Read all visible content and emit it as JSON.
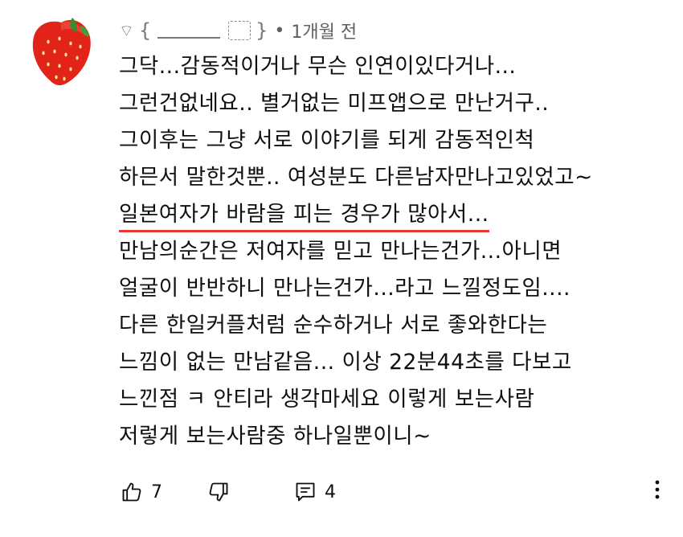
{
  "comment": {
    "author_time": "1개월 전",
    "author_prefix": "⌔",
    "separator": "•",
    "lines": [
      "그닥...감동적이거나 무슨 인연이있다거나...",
      "그런건없네요.. 별거없는 미프앱으로 만난거구..",
      "그이후는 그냥 서로 이야기를 되게 감동적인척",
      "하믄서 말한것뿐.. 여성분도 다른남자만나고있었고~",
      "일본여자가 바람을 피는 경우가 많아서...",
      "만남의순간은 저여자를 믿고 만나는건가...아니면",
      "얼굴이 반반하니 만나는건가...라고 느낄정도임....",
      "다른 한일커플처럼 순수하거나 서로 좋와한다는",
      "느낌이 없는 만남같음... 이상 22분44초를 다보고",
      "느낀점 ㅋ 안티라 생각마세요 이렇게 보는사람",
      "저렇게 보는사람중 하나일뿐이니~"
    ],
    "underline_color": "#e53935"
  },
  "actions": {
    "like_count": "7",
    "reply_count": "4"
  },
  "icons": {
    "avatar": "strawberry-avatar",
    "like": "thumbs-up-icon",
    "dislike": "thumbs-down-icon",
    "reply": "comment-icon",
    "more": "more-vert-icon"
  }
}
